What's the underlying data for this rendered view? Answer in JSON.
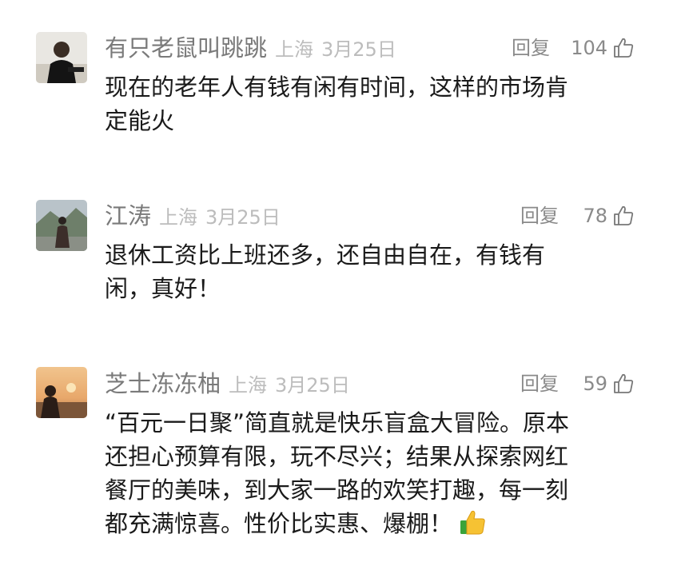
{
  "comments": [
    {
      "username": "有只老鼠叫跳跳",
      "location": "上海",
      "date": "3月25日",
      "reply_label": "回复",
      "like_count": "104",
      "text": "现在的老年人有钱有闲有时间，这样的市场肯\n定能火",
      "avatar_icon": "avatar-man-icon"
    },
    {
      "username": "江涛",
      "location": "上海",
      "date": "3月25日",
      "reply_label": "回复",
      "like_count": "78",
      "text": "退休工资比上班还多，还自由自在，有钱有\n闲，真好！",
      "avatar_icon": "avatar-mountain-icon"
    },
    {
      "username": "芝士冻冻柚",
      "location": "上海",
      "date": "3月25日",
      "reply_label": "回复",
      "like_count": "59",
      "text": "“百元一日聚”简直就是快乐盲盒大冒险。原本\n还担心预算有限，玩不尽兴；结果从探索网红\n餐厅的美味，到大家一路的欢笑打趣，每一刻\n都充满惊喜。性价比实惠、爆棚！",
      "trailing_emoji": "thumbs-up-emoji",
      "avatar_icon": "avatar-sunset-icon"
    }
  ],
  "colors": {
    "username": "#7a7a7a",
    "meta": "#bcbcbc",
    "body": "#1a1a1a",
    "emoji_yellow": "#f6c233"
  }
}
